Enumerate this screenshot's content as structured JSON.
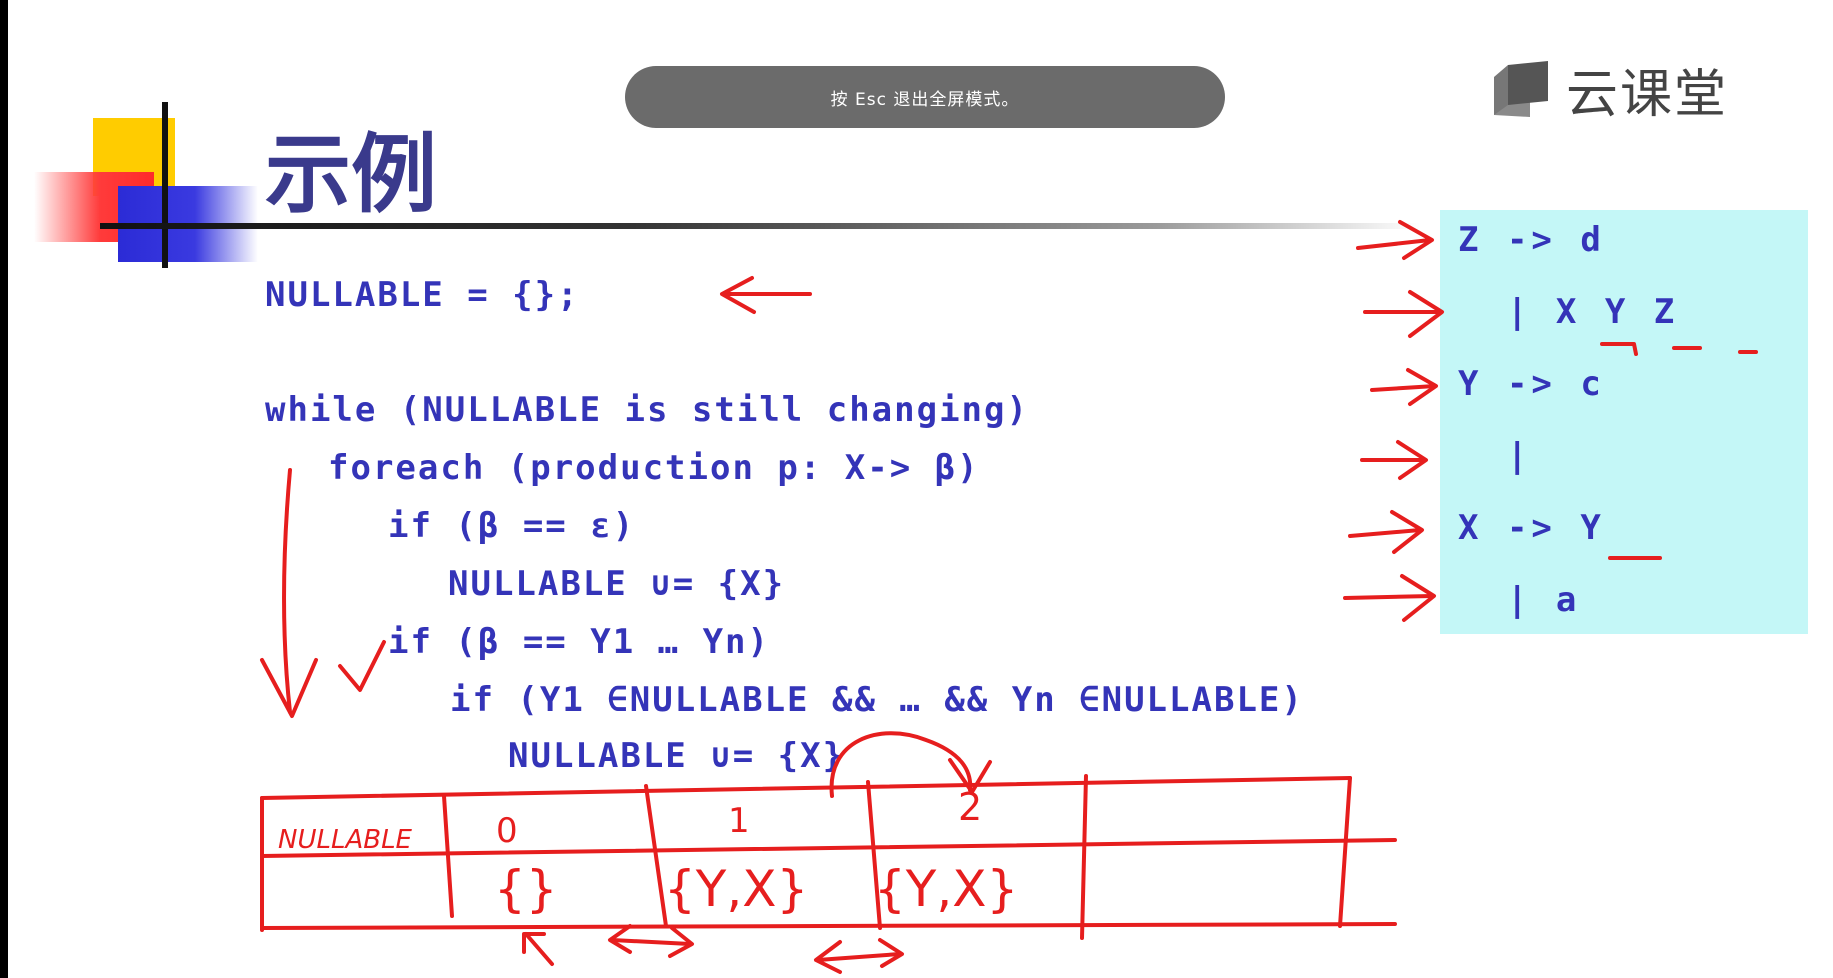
{
  "toast": {
    "text": "按 Esc 退出全屏模式。"
  },
  "logo": {
    "text": "云课堂",
    "icon": "book-icon"
  },
  "slide": {
    "title": "示例",
    "code_lines": [
      "NULLABLE = {};",
      "while (NULLABLE is still changing)",
      "foreach (production p: X-> β)",
      "if (β == ε)",
      "NULLABLE ∪= {X}",
      "if (β == Y1 … Yn)",
      "if (Y1 ∈NULLABLE && … && Yn ∈NULLABLE)",
      "NULLABLE ∪= {X}"
    ],
    "grammar_lines": [
      "Z -> d",
      "  | X Y Z",
      "Y -> c",
      "  |",
      "X -> Y",
      "  | a"
    ],
    "handwritten_table": {
      "header": [
        "NULLABLE",
        "0",
        "1",
        "2",
        ""
      ],
      "row": [
        "",
        "{}",
        "{Y,X}",
        "{Y,X}",
        ""
      ]
    }
  },
  "colors": {
    "code_blue": "#3434b8",
    "title_blue": "#3a3a8c",
    "panel_cyan": "#c4f7f7",
    "ink_red": "#e61e1e",
    "toast_gray": "#6b6b6b"
  }
}
